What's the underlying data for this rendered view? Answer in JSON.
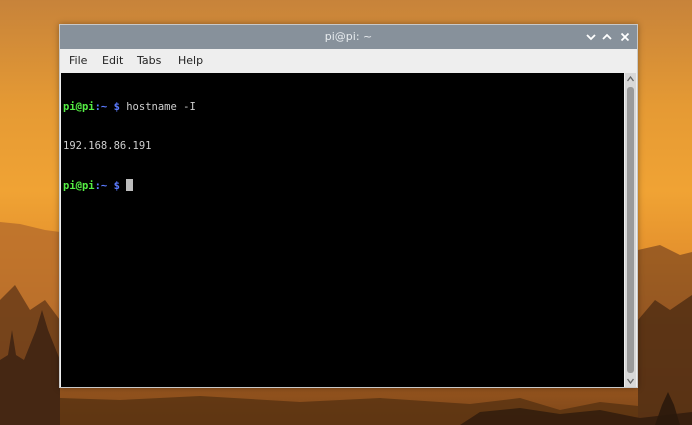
{
  "window": {
    "title": "pi@pi: ~"
  },
  "menu": {
    "file": "File",
    "edit": "Edit",
    "tabs": "Tabs",
    "help": "Help"
  },
  "terminal": {
    "prompt_user": "pi@pi",
    "prompt_path": ":~ ",
    "prompt_symbol": "$",
    "command": " hostname -I",
    "output": "192.168.86.191"
  },
  "colors": {
    "titlebar": "#87919b",
    "terminal_bg": "#000000",
    "prompt_user": "#55ee44",
    "prompt_path": "#5b7bff"
  },
  "icons": {
    "minimize": "chevron-down-icon",
    "maximize": "chevron-up-icon",
    "close": "close-icon"
  }
}
